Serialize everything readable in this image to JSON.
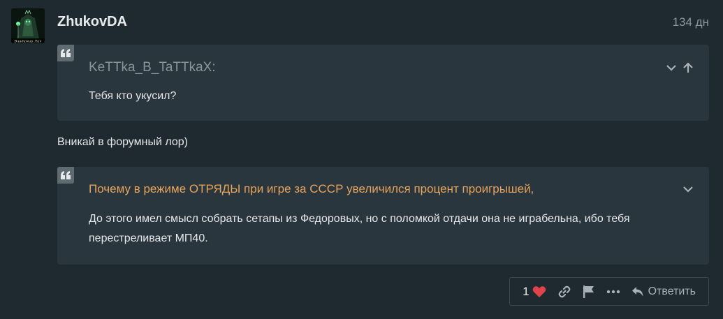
{
  "post": {
    "username": "ZhukovDA",
    "date": "134 дн",
    "avatar_caption": "Владимир Лич",
    "text": "Вникай в форумный лор)"
  },
  "quotes": [
    {
      "author": "KeTTka_B_TaTTkaX:",
      "body": "Тебя кто укусил?",
      "controls": [
        "chevron-down-icon",
        "arrow-up-icon"
      ]
    },
    {
      "title": "Почему в режиме ОТРЯДЫ при игре за СССР увеличился процент проигрышей,",
      "body": "До этого имел смысл собрать сетапы из Федоровых, но с поломкой отдачи она не играбельна, ибо тебя перестреливает МП40.",
      "controls": [
        "chevron-down-icon"
      ]
    }
  ],
  "actions": {
    "like_count": "1",
    "reply_label": "Ответить",
    "icons": [
      "heart-icon",
      "link-icon",
      "flag-icon",
      "more-icon",
      "reply-icon"
    ]
  },
  "colors": {
    "background": "#1f2a30",
    "quote_bg": "#29363d",
    "topic_link": "#e8a35a",
    "heart": "#e0444b",
    "muted": "#8a9599"
  }
}
